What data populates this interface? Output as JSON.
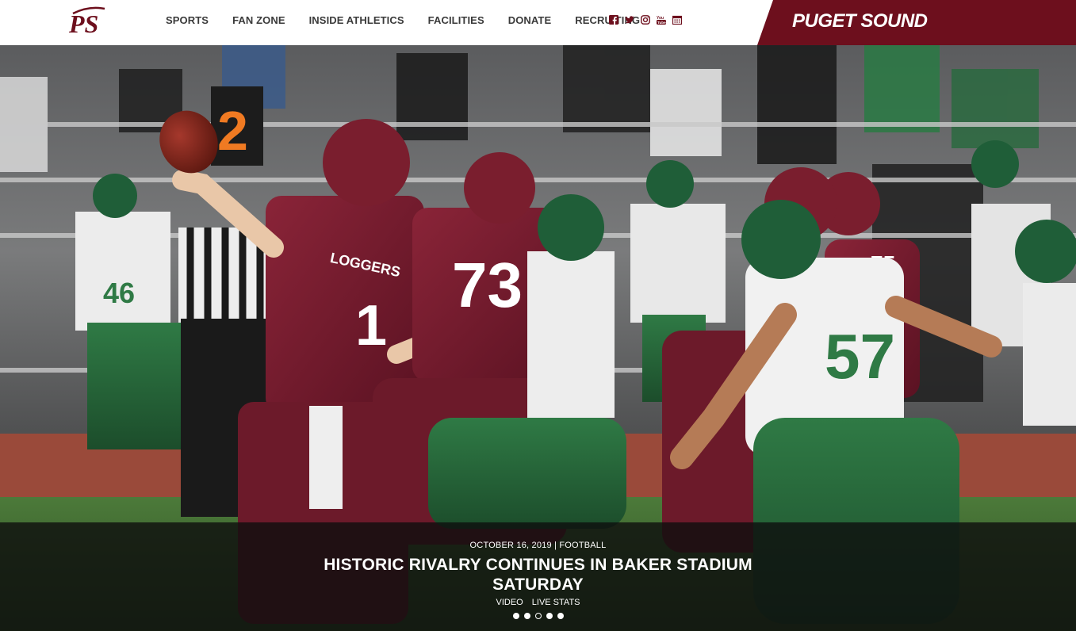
{
  "header": {
    "logo_text": "PS",
    "nav": [
      {
        "label": "SPORTS"
      },
      {
        "label": "FAN ZONE"
      },
      {
        "label": "INSIDE ATHLETICS"
      },
      {
        "label": "FACILITIES"
      },
      {
        "label": "DONATE"
      },
      {
        "label": "RECRUITING"
      }
    ],
    "social_icons": [
      "facebook-icon",
      "twitter-icon",
      "instagram-icon",
      "youtube-icon",
      "calendar-icon"
    ],
    "brand": "PUGET SOUND"
  },
  "hero": {
    "meta": "OCTOBER 16, 2019 | FOOTBALL",
    "title_line1": "HISTORIC RIVALRY CONTINUES IN BAKER STADIUM",
    "title_line2": "SATURDAY",
    "links": [
      {
        "label": "VIDEO"
      },
      {
        "label": "LIVE STATS"
      }
    ],
    "slides": 5,
    "active_slide": 3,
    "jersey_numbers": [
      "1",
      "73",
      "75",
      "57",
      "46"
    ],
    "jersey_text": "LOGGERS",
    "down_marker": "2"
  },
  "colors": {
    "maroon": "#6d0f1d",
    "header_bg": "#ffffff",
    "nav_text": "#3a3a3a",
    "caption_bg": "rgba(14,14,14,0.80)"
  }
}
